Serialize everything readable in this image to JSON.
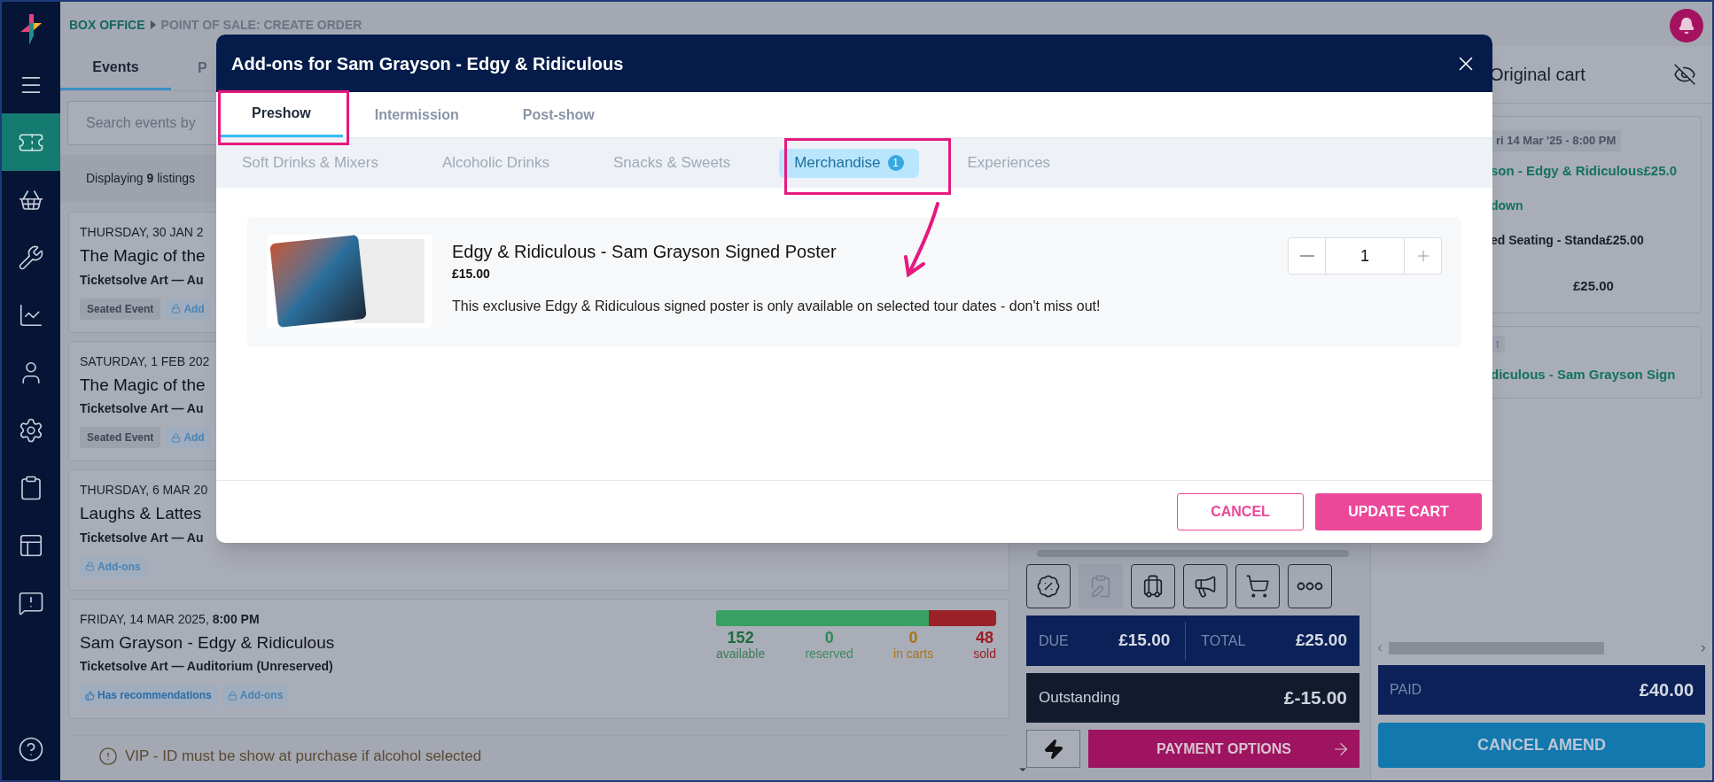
{
  "sidebar": {
    "items": [
      {
        "selected": true
      },
      {
        "selected": false
      },
      {
        "selected": false
      },
      {
        "selected": false
      },
      {
        "selected": false
      },
      {
        "selected": false
      },
      {
        "selected": false
      },
      {
        "selected": false
      },
      {
        "selected": false
      }
    ]
  },
  "breadcrumb": [
    "BOX OFFICE",
    "POINT OF SALE: CREATE ORDER"
  ],
  "events_panel": {
    "tabs": [
      {
        "label": "Events",
        "selected": true
      },
      {
        "label": "P",
        "selected": false
      }
    ],
    "search": {
      "placeholder": "Search events by"
    },
    "listing_count": "Displaying **9** listings",
    "events": [
      {
        "date": "THURSDAY, 30 JAN 2",
        "title": "The Magic of the",
        "venue": "Ticketsolve Art — Au",
        "badges": [
          {
            "kind": "tag",
            "label": "Seated Event"
          },
          {
            "kind": "addons",
            "label": "Add"
          }
        ]
      },
      {
        "date": "SATURDAY, 1 FEB 202",
        "title": "The Magic of the",
        "venue": "Ticketsolve Art — Au",
        "badges": [
          {
            "kind": "tag",
            "label": "Seated Event"
          },
          {
            "kind": "addons",
            "label": "Add"
          }
        ]
      },
      {
        "date": "THURSDAY, 6 MAR 20",
        "title": "Laughs & Lattes",
        "venue": "Ticketsolve Art — Au",
        "badges": [
          {
            "kind": "addons",
            "label": "Add-ons"
          }
        ]
      },
      {
        "date": "FRIDAY, 14 MAR 2025, **8:00 PM**",
        "title": "Sam Grayson - Edgy & Ridiculous",
        "venue": "Ticketsolve Art — Auditorium (Unreserved)",
        "badges": [
          {
            "kind": "recommend",
            "label": "Has recommendations"
          },
          {
            "kind": "addons",
            "label": "Add-ons"
          }
        ],
        "availability": {
          "level": 0.76,
          "stats": [
            {
              "kind": "available",
              "value": "152",
              "label": "available"
            },
            {
              "kind": "reserved",
              "value": "0",
              "label": "reserved"
            },
            {
              "kind": "carts",
              "value": "0",
              "label": "in carts"
            },
            {
              "kind": "sold",
              "value": "48",
              "label": "sold"
            }
          ]
        }
      }
    ],
    "notice": "VIP - ID must be show at purchase if alcohol selected"
  },
  "order_panel": {
    "tools": [
      {
        "disabled": false
      },
      {
        "disabled": true
      },
      {
        "disabled": false
      },
      {
        "disabled": false
      },
      {
        "disabled": false
      },
      {
        "disabled": false
      }
    ],
    "due_label": "DUE",
    "due": "£15.00",
    "total_label": "TOTAL",
    "total": "£25.00",
    "outstanding_label": "Outstanding",
    "outstanding": "£-15.00",
    "payment_button": "PAYMENT OPTIONS"
  },
  "cart": {
    "title": "Original cart",
    "date_badge": "ri 14 Mar '25 - 8:00 PM",
    "event_title": "son - Edgy & Ridiculous£25.0",
    "breakdown_link": "down",
    "line": "ed Seating - Standa£25.00",
    "subtotal": "£25.00",
    "second_badge": "t",
    "second_title": "diculous - Sam Grayson Sign",
    "paid_label": "PAID",
    "paid": "£40.00",
    "cancel_amend": "CANCEL AMEND"
  },
  "modal": {
    "title": "Add-ons for Sam Grayson - Edgy & Ridiculous",
    "tabs": [
      {
        "label": "Preshow",
        "selected": true
      },
      {
        "label": "Intermission",
        "selected": false
      },
      {
        "label": "Post-show",
        "selected": false
      }
    ],
    "categories": [
      {
        "label": "Soft Drinks & Mixers",
        "selected": false
      },
      {
        "label": "Alcoholic Drinks",
        "selected": false
      },
      {
        "label": "Snacks & Sweets",
        "selected": false
      },
      {
        "label": "Merchandise",
        "selected": true,
        "count": "1"
      },
      {
        "label": "Experiences",
        "selected": false
      }
    ],
    "product": {
      "name": "Edgy & Ridiculous - Sam Grayson Signed Poster",
      "price": "£15.00",
      "description": "This exclusive Edgy & Ridiculous signed poster is only available on selected tour dates - don't miss out!",
      "quantity": "1"
    },
    "cancel_button": "CANCEL",
    "update_button": "UPDATE CART"
  }
}
